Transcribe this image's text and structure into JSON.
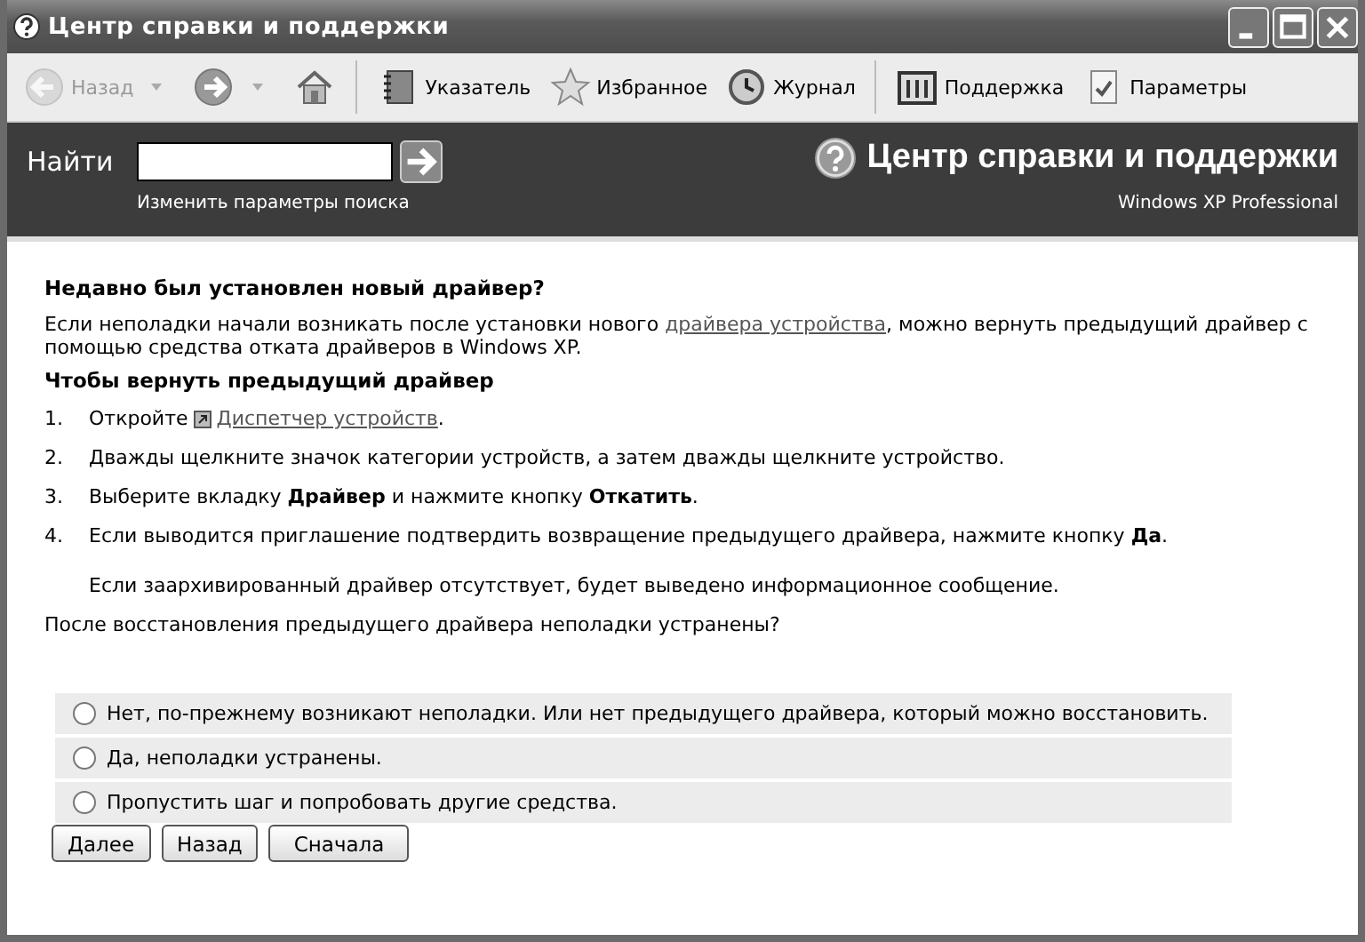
{
  "window": {
    "title": "Центр справки и поддержки"
  },
  "toolbar": [
    {
      "kind": "back",
      "label": "Назад",
      "disabled": true
    },
    {
      "kind": "forward"
    },
    {
      "kind": "home"
    },
    {
      "kind": "index",
      "label": "Указатель"
    },
    {
      "kind": "favorites",
      "label": "Избранное"
    },
    {
      "kind": "history",
      "label": "Журнал"
    },
    {
      "kind": "support",
      "label": "Поддержка"
    },
    {
      "kind": "options",
      "label": "Параметры"
    }
  ],
  "search": {
    "label": "Найти",
    "options_link": "Изменить параметры поиска"
  },
  "banner": {
    "title": "Центр справки и поддержки",
    "edition": "Windows XP Professional"
  },
  "article": {
    "heading": "Недавно был установлен новый драйвер?",
    "intro": {
      "before": "Если неполадки начали возникать после установки нового ",
      "link": "драйвера устройства",
      "after": ", можно вернуть предыдущий драйвер с помощью средства отката драйверов в Windows XP."
    },
    "subheading": "Чтобы вернуть предыдущий драйвер",
    "steps": [
      {
        "number": "1.",
        "text": "Откройте",
        "link": "Диспетчер устройств",
        "after": "."
      },
      {
        "number": "2.",
        "text": "Дважды щелкните значок категории устройств, а затем дважды щелкните устройство."
      },
      {
        "number": "3.",
        "text": "Выберите вкладку **Драйвер** и нажмите кнопку **Откатить**."
      },
      {
        "number": "4.",
        "text": "Если выводится приглашение подтвердить возвращение предыдущего драйвера, нажмите кнопку **Да**.",
        "note": "Если заархивированный драйвер отсутствует, будет выведено информационное сообщение."
      }
    ],
    "question": "После восстановления предыдущего драйвера неполадки устранены?",
    "options": [
      {
        "label": "Нет, по-прежнему возникают неполадки. Или нет предыдущего драйвера, который можно восстановить.",
        "selected": false
      },
      {
        "label": "Да, неполадки устранены.",
        "selected": false
      },
      {
        "label": "Пропустить шаг и попробовать другие средства.",
        "selected": false
      }
    ],
    "buttons": [
      "Далее",
      "Назад",
      "Сначала"
    ]
  }
}
